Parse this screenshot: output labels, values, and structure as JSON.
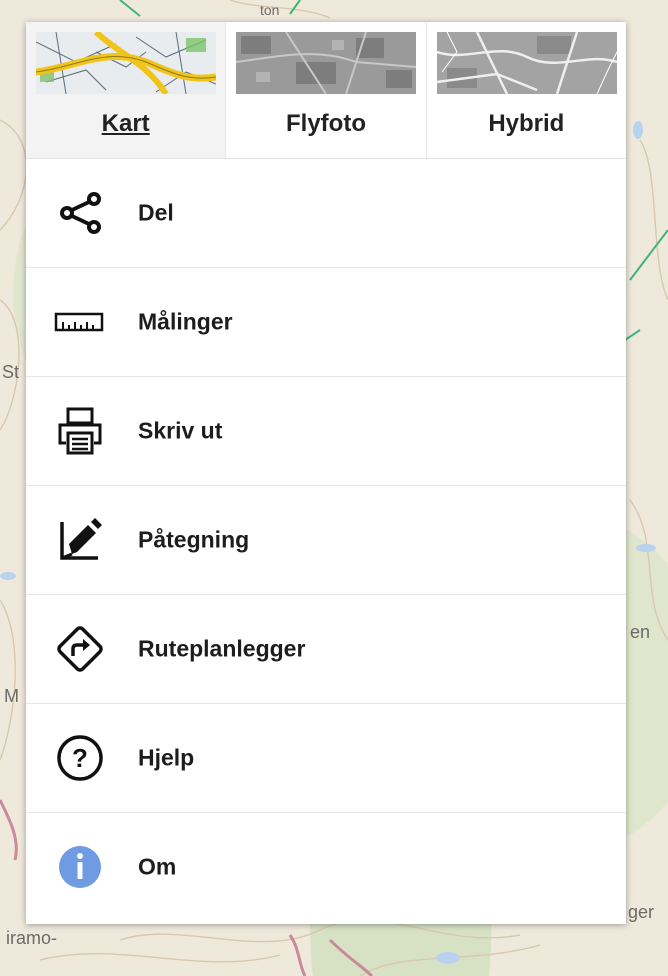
{
  "colors": {
    "accent": "#6f9be3",
    "road_yellow": "#f0c419",
    "map_green": "#3fb37f"
  },
  "map": {
    "labels": [
      "St",
      "en",
      "M",
      "iramo-",
      "ger",
      "ton"
    ]
  },
  "layers": [
    {
      "label": "Kart",
      "active": true,
      "thumb": "map-thumbnail"
    },
    {
      "label": "Flyfoto",
      "active": false,
      "thumb": "aerial-thumbnail"
    },
    {
      "label": "Hybrid",
      "active": false,
      "thumb": "hybrid-thumbnail"
    }
  ],
  "items": [
    {
      "label": "Del",
      "icon": "share-icon"
    },
    {
      "label": "Målinger",
      "icon": "ruler-icon"
    },
    {
      "label": "Skriv ut",
      "icon": "printer-icon"
    },
    {
      "label": "Påtegning",
      "icon": "draw-icon"
    },
    {
      "label": "Ruteplanlegger",
      "icon": "route-icon"
    },
    {
      "label": "Hjelp",
      "icon": "help-icon"
    },
    {
      "label": "Om",
      "icon": "info-icon"
    }
  ]
}
